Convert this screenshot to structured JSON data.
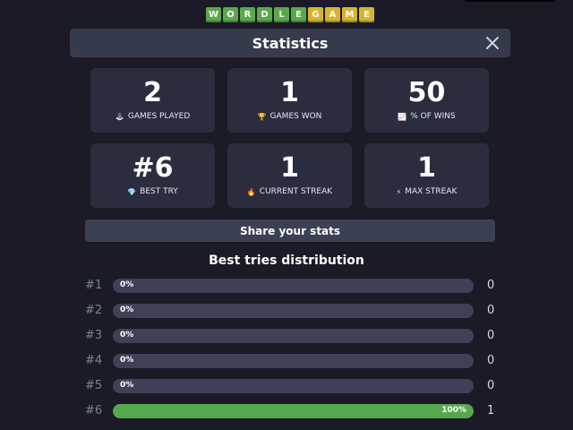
{
  "logo": {
    "letters": [
      "W",
      "O",
      "R",
      "D",
      "L",
      "E",
      "G",
      "A",
      "M",
      "E"
    ],
    "colors": [
      "green",
      "green",
      "green",
      "green",
      "green",
      "green",
      "yellow",
      "yellow",
      "yellow",
      "yellow"
    ]
  },
  "header": {
    "title": "Statistics",
    "close_icon": "close-icon"
  },
  "stats": [
    {
      "value": "2",
      "label": "GAMES PLAYED",
      "icon": "joystick-icon",
      "glyph": "🕹"
    },
    {
      "value": "1",
      "label": "GAMES WON",
      "icon": "trophy-icon",
      "glyph": "🏆"
    },
    {
      "value": "50",
      "label": "% OF WINS",
      "icon": "chart-icon",
      "glyph": "📈"
    },
    {
      "value": "#6",
      "label": "BEST TRY",
      "icon": "diamond-icon",
      "glyph": "💎"
    },
    {
      "value": "1",
      "label": "CURRENT STREAK",
      "icon": "fire-icon",
      "glyph": "🔥"
    },
    {
      "value": "1",
      "label": "MAX STREAK",
      "icon": "lightning-icon",
      "glyph": "⚡"
    }
  ],
  "share": {
    "label": "Share your stats"
  },
  "distribution": {
    "title": "Best tries distribution",
    "rows": [
      {
        "index": "#1",
        "percent_label": "0%",
        "fraction": 0,
        "count": "0"
      },
      {
        "index": "#2",
        "percent_label": "0%",
        "fraction": 0,
        "count": "0"
      },
      {
        "index": "#3",
        "percent_label": "0%",
        "fraction": 0,
        "count": "0"
      },
      {
        "index": "#4",
        "percent_label": "0%",
        "fraction": 0,
        "count": "0"
      },
      {
        "index": "#5",
        "percent_label": "0%",
        "fraction": 0,
        "count": "0"
      },
      {
        "index": "#6",
        "percent_label": "100%",
        "fraction": 1,
        "count": "1"
      }
    ]
  },
  "colors": {
    "background": "#1a1b26",
    "card": "#2a2d3e",
    "header": "#363a4d",
    "bar_track": "#3e4157",
    "bar_fill": "#56a84f",
    "tile_green": "#5aa84a",
    "tile_yellow": "#d6b42f"
  }
}
